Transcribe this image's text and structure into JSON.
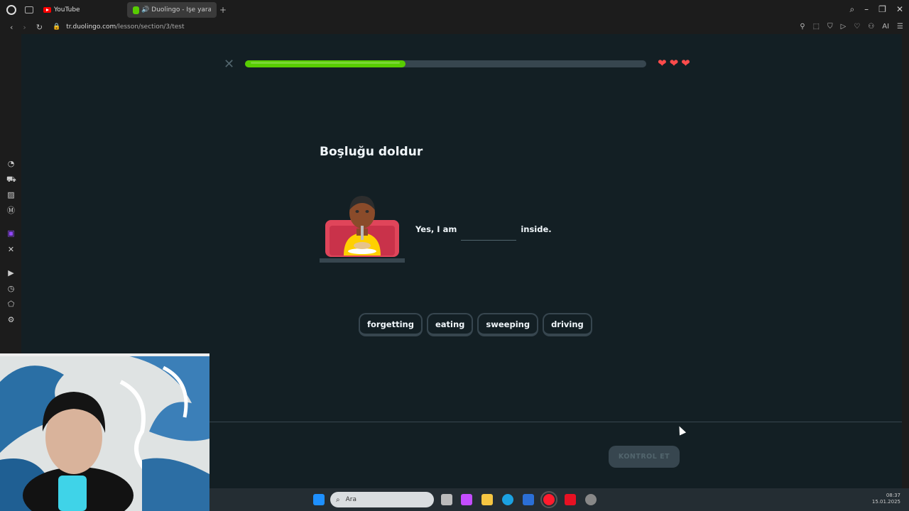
{
  "browser": {
    "tabs": [
      {
        "label": "YouTube"
      },
      {
        "label": "Duolingo - İşe yarayan"
      }
    ],
    "url_domain": "tr.duolingo.com",
    "url_path": "/lesson/section/3/test",
    "ai_label": "AI"
  },
  "lesson": {
    "progress": 0.4,
    "hearts": 3,
    "title": "Boşluğu doldur",
    "sentence_before": "Yes, I am",
    "sentence_after": "inside.",
    "word_bank": [
      "forgetting",
      "eating",
      "sweeping",
      "driving"
    ],
    "check_label": "KONTROL ET"
  },
  "taskbar": {
    "search_placeholder": "Ara",
    "time": "08:37",
    "date": "15.01.2025"
  },
  "colors": {
    "background": "#131f24",
    "progress": "#58cc02",
    "heart": "#ff4b4b",
    "border": "#37464f"
  }
}
